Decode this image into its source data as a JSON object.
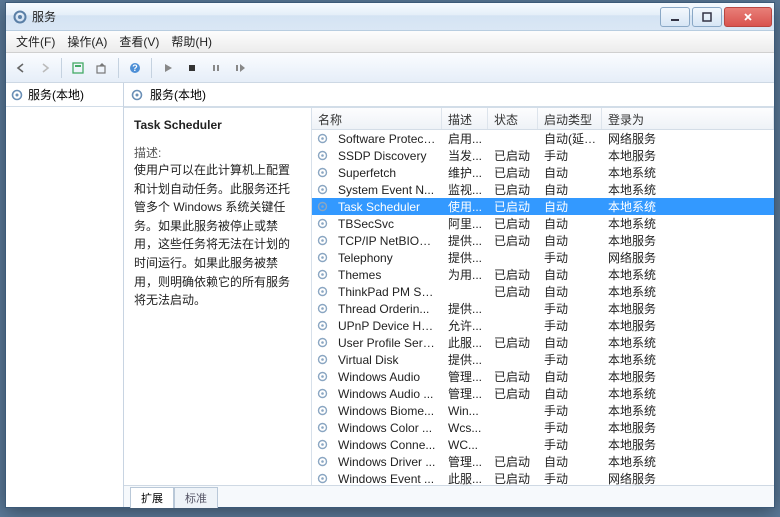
{
  "window": {
    "title": "服务"
  },
  "menu": {
    "file": "文件(F)",
    "action": "操作(A)",
    "view": "查看(V)",
    "help": "帮助(H)"
  },
  "left": {
    "header": "服务(本地)"
  },
  "right": {
    "header": "服务(本地)"
  },
  "detail": {
    "title": "Task Scheduler",
    "desc_label": "描述:",
    "desc": "使用户可以在此计算机上配置和计划自动任务。此服务还托管多个 Windows 系统关键任务。如果此服务被停止或禁用，这些任务将无法在计划的时间运行。如果此服务被禁用，则明确依赖它的所有服务将无法启动。"
  },
  "columns": {
    "name": "名称",
    "desc": "描述",
    "status": "状态",
    "startup": "启动类型",
    "logon": "登录为"
  },
  "tabs": {
    "extended": "扩展",
    "standard": "标准"
  },
  "services": [
    {
      "name": "Software Protect...",
      "desc": "启用...",
      "status": "",
      "startup": "自动(延迟...",
      "logon": "网络服务",
      "sel": false
    },
    {
      "name": "SSDP Discovery",
      "desc": "当发...",
      "status": "已启动",
      "startup": "手动",
      "logon": "本地服务",
      "sel": false
    },
    {
      "name": "Superfetch",
      "desc": "维护...",
      "status": "已启动",
      "startup": "自动",
      "logon": "本地系统",
      "sel": false
    },
    {
      "name": "System Event N...",
      "desc": "监视...",
      "status": "已启动",
      "startup": "自动",
      "logon": "本地系统",
      "sel": false
    },
    {
      "name": "Task Scheduler",
      "desc": "使用...",
      "status": "已启动",
      "startup": "自动",
      "logon": "本地系统",
      "sel": true
    },
    {
      "name": "TBSecSvc",
      "desc": "阿里...",
      "status": "已启动",
      "startup": "自动",
      "logon": "本地系统",
      "sel": false
    },
    {
      "name": "TCP/IP NetBIOS ...",
      "desc": "提供...",
      "status": "已启动",
      "startup": "自动",
      "logon": "本地服务",
      "sel": false
    },
    {
      "name": "Telephony",
      "desc": "提供...",
      "status": "",
      "startup": "手动",
      "logon": "网络服务",
      "sel": false
    },
    {
      "name": "Themes",
      "desc": "为用...",
      "status": "已启动",
      "startup": "自动",
      "logon": "本地系统",
      "sel": false
    },
    {
      "name": "ThinkPad PM Se...",
      "desc": "",
      "status": "已启动",
      "startup": "自动",
      "logon": "本地系统",
      "sel": false
    },
    {
      "name": "Thread Orderin...",
      "desc": "提供...",
      "status": "",
      "startup": "手动",
      "logon": "本地服务",
      "sel": false
    },
    {
      "name": "UPnP Device Host",
      "desc": "允许...",
      "status": "",
      "startup": "手动",
      "logon": "本地服务",
      "sel": false
    },
    {
      "name": "User Profile Serv...",
      "desc": "此服...",
      "status": "已启动",
      "startup": "自动",
      "logon": "本地系统",
      "sel": false
    },
    {
      "name": "Virtual Disk",
      "desc": "提供...",
      "status": "",
      "startup": "手动",
      "logon": "本地系统",
      "sel": false
    },
    {
      "name": "Windows Audio",
      "desc": "管理...",
      "status": "已启动",
      "startup": "自动",
      "logon": "本地服务",
      "sel": false
    },
    {
      "name": "Windows Audio ...",
      "desc": "管理...",
      "status": "已启动",
      "startup": "自动",
      "logon": "本地系统",
      "sel": false
    },
    {
      "name": "Windows Biome...",
      "desc": "Win...",
      "status": "",
      "startup": "手动",
      "logon": "本地系统",
      "sel": false
    },
    {
      "name": "Windows Color ...",
      "desc": "Wcs...",
      "status": "",
      "startup": "手动",
      "logon": "本地服务",
      "sel": false
    },
    {
      "name": "Windows Conne...",
      "desc": "WC...",
      "status": "",
      "startup": "手动",
      "logon": "本地服务",
      "sel": false
    },
    {
      "name": "Windows Driver ...",
      "desc": "管理...",
      "status": "已启动",
      "startup": "自动",
      "logon": "本地系统",
      "sel": false
    },
    {
      "name": "Windows Event ...",
      "desc": "此服...",
      "status": "已启动",
      "startup": "手动",
      "logon": "网络服务",
      "sel": false
    }
  ]
}
